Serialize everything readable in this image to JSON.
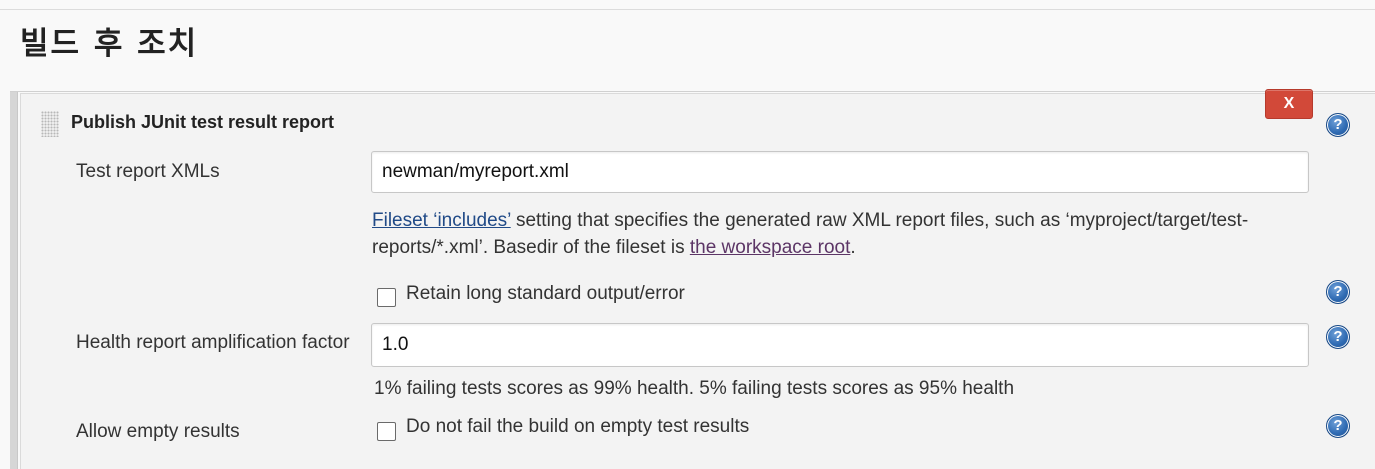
{
  "section": {
    "title": "빌드 후 조치"
  },
  "step": {
    "title": "Publish JUnit test result report",
    "delete_label": "X",
    "help_glyph": "?"
  },
  "fields": {
    "test_report": {
      "label": "Test report XMLs",
      "value": "newman/myreport.xml",
      "description_link1": "Fileset ‘includes’",
      "description_text1": " setting that specifies the generated raw XML report files, such as ‘myproject/target/test-reports/*.xml’. Basedir of the fileset is ",
      "description_link2": "the workspace root",
      "description_text2": "."
    },
    "retain_output": {
      "label": "Retain long standard output/error",
      "checked": false
    },
    "health_factor": {
      "label": "Health report amplification factor",
      "value": "1.0",
      "hint": "1% failing tests scores as 99% health. 5% failing tests scores as 95% health"
    },
    "allow_empty": {
      "label": "Allow empty results",
      "checkbox_label": "Do not fail the build on empty test results",
      "checked": false
    }
  },
  "colors": {
    "delete_button": "#d24939",
    "help_icon": "#2f6bb3",
    "link": "#204a87",
    "visited_link": "#5c3566"
  }
}
